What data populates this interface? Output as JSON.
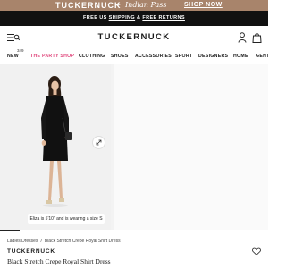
{
  "promo": {
    "brand": "TUCKERNUCK",
    "plus": "+",
    "collab": "Indian Pass",
    "cta": "SHOP NOW"
  },
  "shipping_bar": {
    "prefix": "FREE US ",
    "shipping": "SHIPPING",
    "middle": " & ",
    "returns": "FREE RETURNS"
  },
  "header": {
    "logo": "TUCKERNUCK",
    "icons": [
      "menu-icon",
      "search-icon",
      "user-icon",
      "shopping-bag-icon"
    ]
  },
  "nav": {
    "badge": "349",
    "items": [
      "NEW",
      "THE PARTY SHOP",
      "CLOTHING",
      "SHOES",
      "ACCESSORIES",
      "SPORT",
      "DESIGNERS",
      "HOME",
      "GENT"
    ],
    "highlight_color": "#e0457b"
  },
  "gallery": {
    "model_note": "Eliza is 5'10\" and is wearing a size S",
    "expand_icon": "expand-icon"
  },
  "product": {
    "breadcrumb": [
      "Ladies Dresses",
      "/",
      "Black Stretch Crepe Royal Shirt Dress"
    ],
    "brand": "TUCKERNUCK",
    "title": "Black Stretch Crepe Royal Shirt Dress",
    "wishlist_icon": "heart-icon"
  },
  "colors": {
    "promo_bar": "#a8846b",
    "shipping_bar": "#111111",
    "accent_pink": "#e0457b"
  }
}
